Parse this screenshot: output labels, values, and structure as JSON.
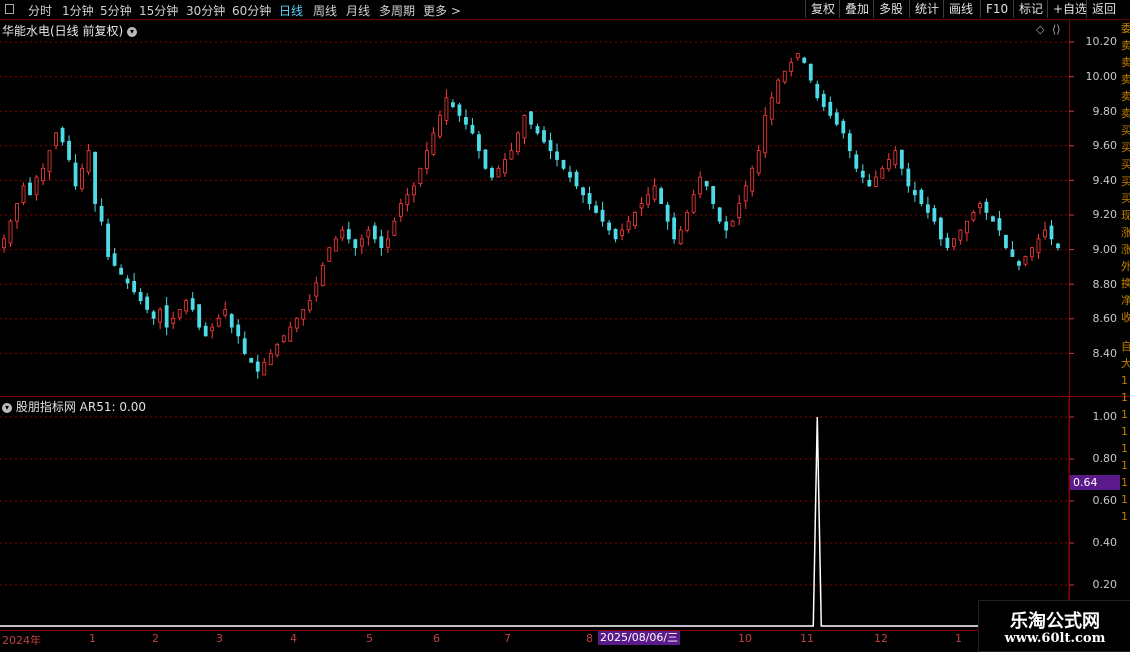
{
  "toolbar": {
    "periods": [
      "分时",
      "1分钟",
      "5分钟",
      "15分钟",
      "30分钟",
      "60分钟",
      "日线",
      "周线",
      "月线",
      "多周期",
      "更多 >"
    ],
    "active_period": "日线",
    "right_buttons": [
      "复权",
      "叠加",
      "多股",
      "统计",
      "画线",
      "F10",
      "标记",
      "+自选",
      "返回"
    ]
  },
  "chart_title": "华能水电(日线 前复权)",
  "price_axis": [
    "10.20",
    "10.00",
    "9.80",
    "9.60",
    "9.40",
    "9.20",
    "9.00",
    "8.80",
    "8.60",
    "8.40"
  ],
  "indicator": {
    "title": "股朋指标网 AR51: 0.00",
    "axis": [
      "1.00",
      "0.80",
      "0.60",
      "0.40",
      "0.20"
    ],
    "current_value": "0.64"
  },
  "date_axis": {
    "labels": [
      {
        "text": "2024年"
      },
      {
        "text": "1"
      },
      {
        "text": "2"
      },
      {
        "text": "3"
      },
      {
        "text": "4"
      },
      {
        "text": "5"
      },
      {
        "text": "6"
      },
      {
        "text": "7"
      },
      {
        "text": "8"
      },
      {
        "text": "10"
      },
      {
        "text": "11"
      },
      {
        "text": "12"
      },
      {
        "text": "1"
      }
    ],
    "selected": "2025/08/06/三"
  },
  "side_strip": [
    "委",
    "卖",
    "卖",
    "卖",
    "卖",
    "卖",
    "买",
    "买",
    "买",
    "买",
    "买",
    "现",
    "涨",
    "涨",
    "外",
    "换",
    "净",
    "收"
  ],
  "side_strip2": [
    "自",
    "大",
    "1",
    "1",
    "1",
    "1",
    "1",
    "1",
    "1",
    "1",
    "1"
  ],
  "watermark": {
    "line1": "乐淘公式网",
    "line2": "www.60lt.com"
  },
  "colors": {
    "up": "#ff3c3c",
    "down": "#4ddbe6",
    "grid": "#8a0000",
    "signal": "#ffffff"
  },
  "chart_data": {
    "type": "candlestick",
    "close_series": [
      9.1,
      9.2,
      9.3,
      9.4,
      9.35,
      9.45,
      9.5,
      9.6,
      9.7,
      9.65,
      9.55,
      9.4,
      9.5,
      9.6,
      9.3,
      9.2,
      9.0,
      8.95,
      8.9,
      8.85,
      8.8,
      8.75,
      8.7,
      8.65,
      8.7,
      8.6,
      8.65,
      8.7,
      8.75,
      8.7,
      8.6,
      8.55,
      8.6,
      8.65,
      8.7,
      8.6,
      8.55,
      8.45,
      8.4,
      8.35,
      8.4,
      8.45,
      8.5,
      8.55,
      8.6,
      8.65,
      8.7,
      8.75,
      8.85,
      8.95,
      9.05,
      9.1,
      9.15,
      9.1,
      9.05,
      9.1,
      9.15,
      9.1,
      9.05,
      9.1,
      9.2,
      9.3,
      9.35,
      9.4,
      9.5,
      9.6,
      9.7,
      9.8,
      9.9,
      9.85,
      9.8,
      9.75,
      9.7,
      9.6,
      9.5,
      9.45,
      9.5,
      9.55,
      9.6,
      9.7,
      9.8,
      9.75,
      9.7,
      9.65,
      9.6,
      9.55,
      9.5,
      9.45,
      9.4,
      9.35,
      9.3,
      9.25,
      9.2,
      9.15,
      9.1,
      9.15,
      9.2,
      9.25,
      9.3,
      9.35,
      9.4,
      9.3,
      9.2,
      9.1,
      9.15,
      9.25,
      9.35,
      9.45,
      9.4,
      9.3,
      9.2,
      9.15,
      9.2,
      9.3,
      9.4,
      9.5,
      9.6,
      9.8,
      9.9,
      10.0,
      10.05,
      10.1,
      10.15,
      10.1,
      10.0,
      9.9,
      9.85,
      9.8,
      9.75,
      9.7,
      9.6,
      9.5,
      9.45,
      9.4,
      9.45,
      9.5,
      9.55,
      9.6,
      9.5,
      9.4,
      9.35,
      9.3,
      9.25,
      9.2,
      9.1,
      9.05,
      9.1,
      9.15,
      9.2,
      9.25,
      9.3,
      9.25,
      9.2,
      9.15,
      9.05,
      9.0,
      8.95,
      9.0,
      9.05,
      9.1,
      9.15,
      9.1,
      9.05
    ],
    "indicator_spike_index": 125,
    "indicator_values_note": "AR51 zero except single spike",
    "ylim": [
      8.3,
      10.25
    ]
  }
}
